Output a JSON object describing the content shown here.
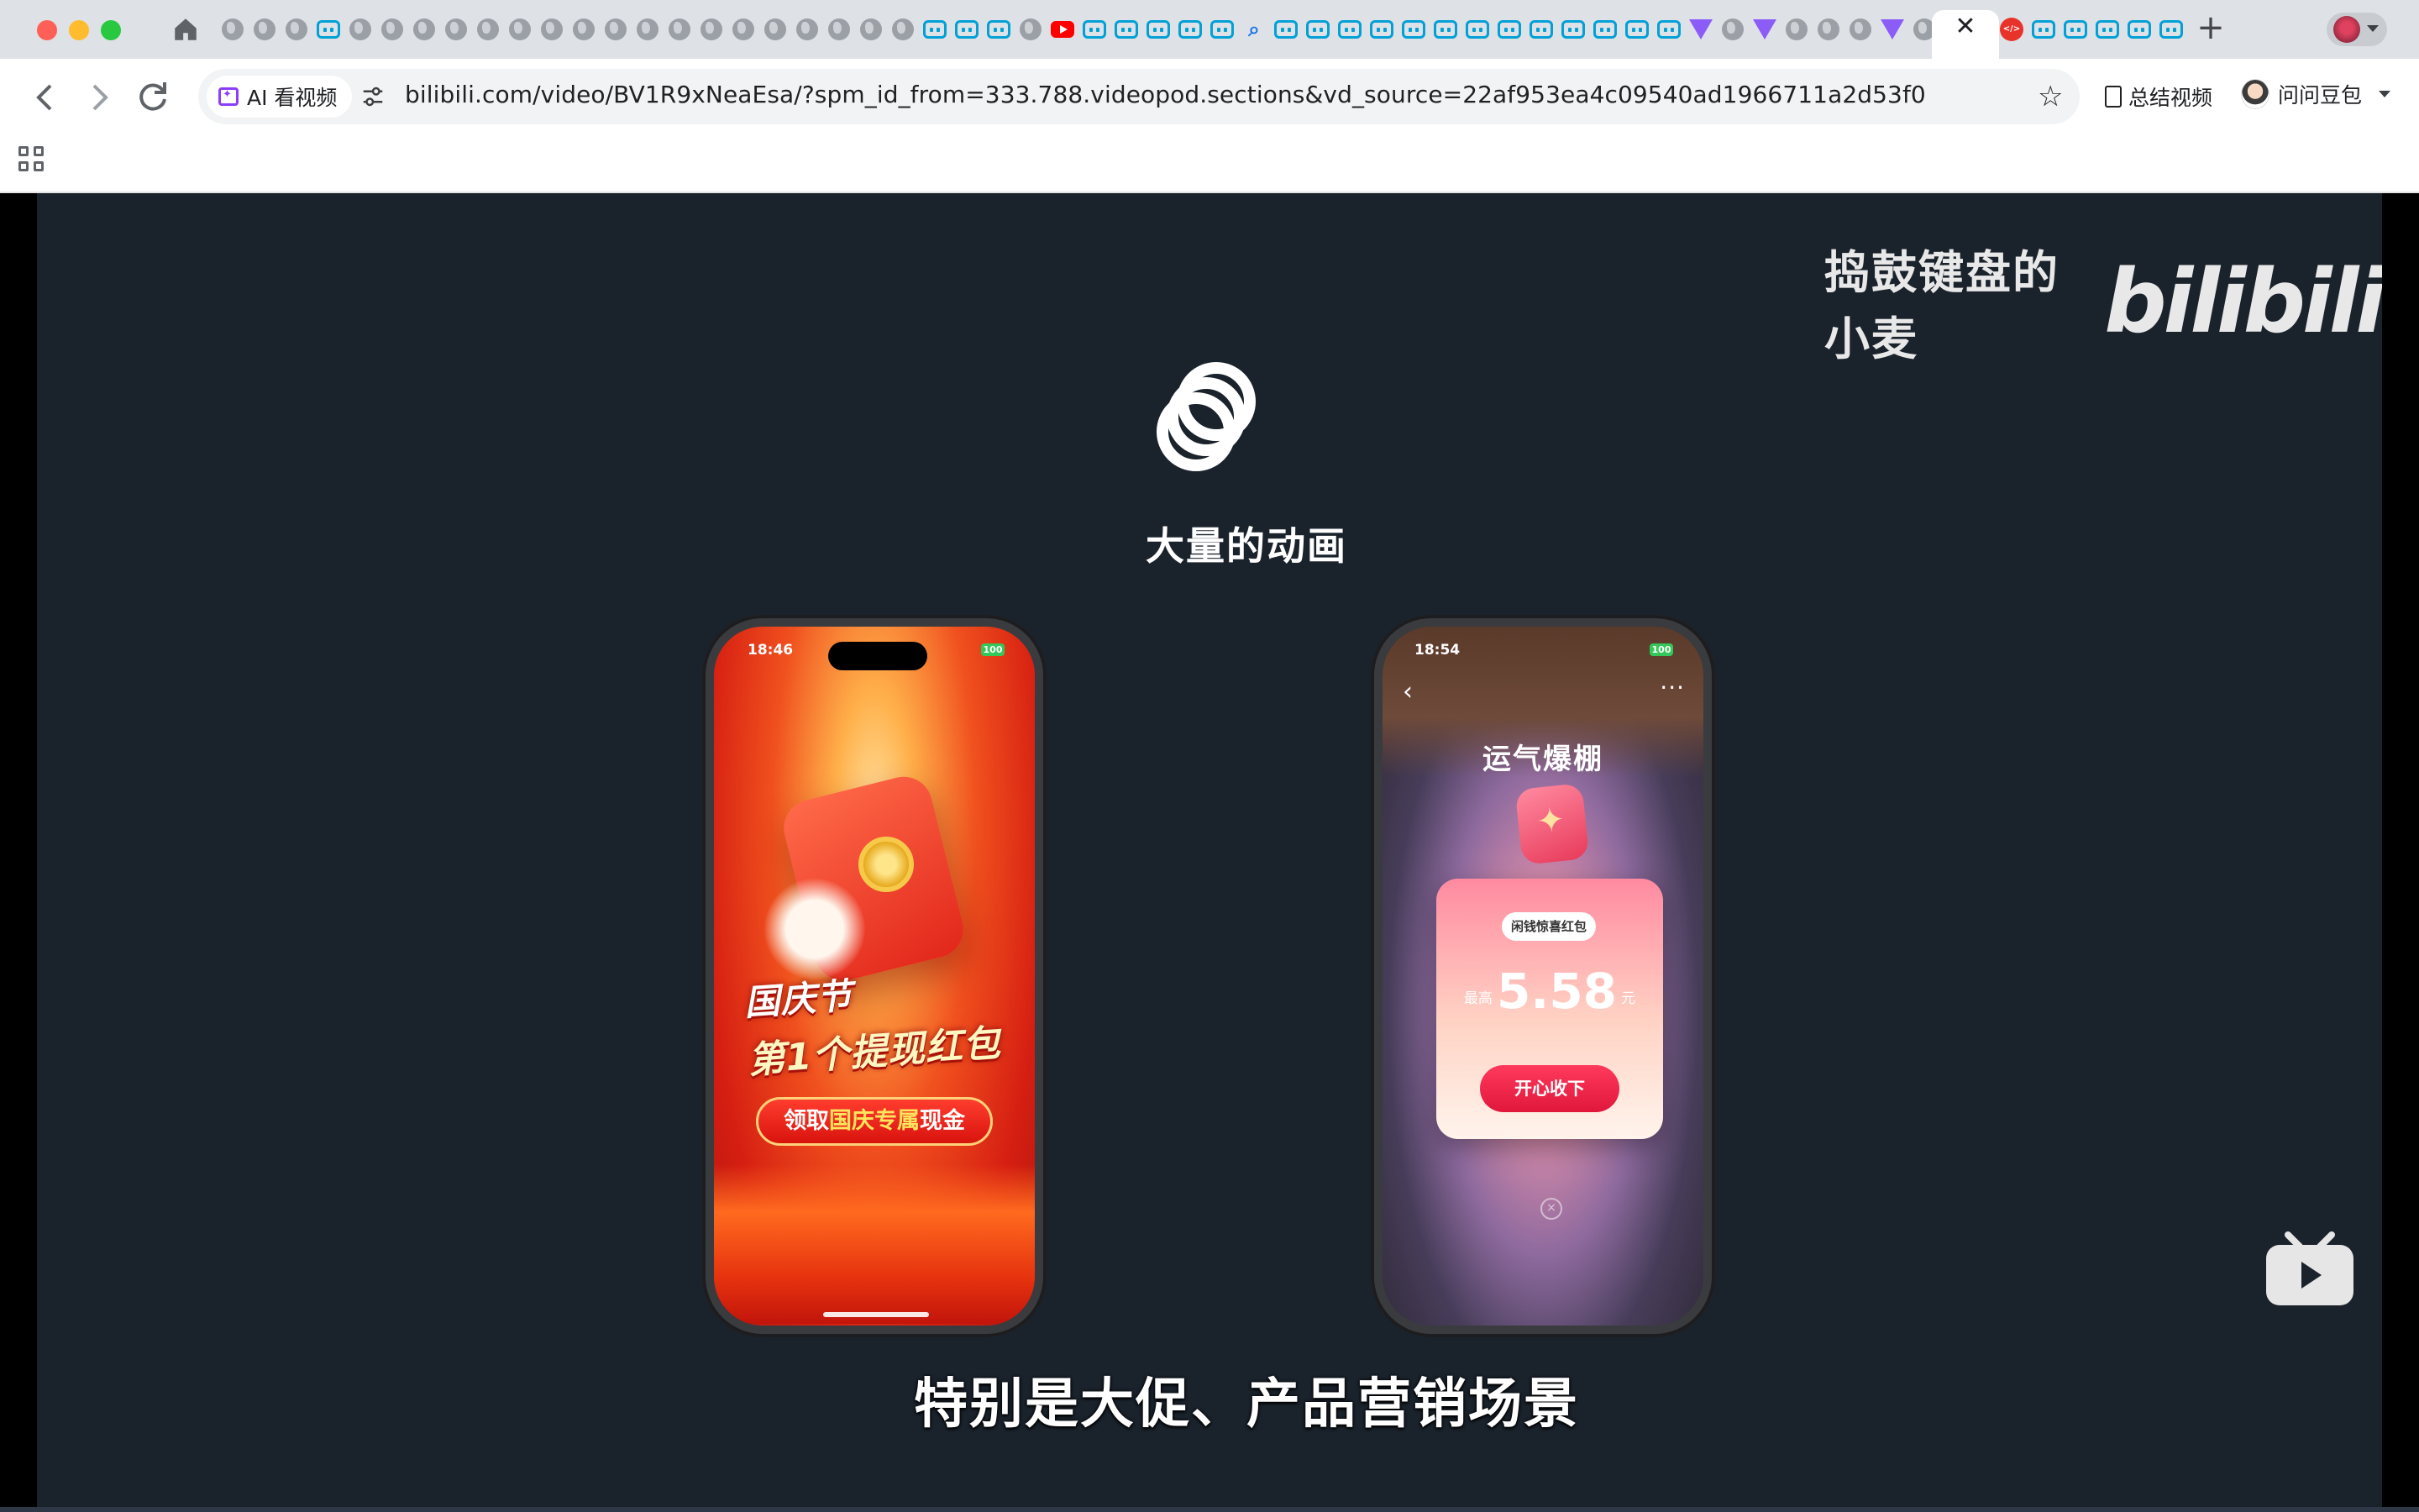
{
  "tabs": {
    "favicons": [
      "globe-icon",
      "globe-icon",
      "globe-icon",
      "bilibili-icon",
      "globe-icon",
      "globe-icon",
      "globe-icon",
      "globe-icon",
      "globe-icon",
      "globe-icon",
      "globe-icon",
      "globe-icon",
      "globe-icon",
      "globe-icon",
      "globe-icon",
      "globe-icon",
      "globe-icon",
      "globe-icon",
      "globe-icon",
      "globe-icon",
      "globe-icon",
      "globe-icon",
      "bilibili-icon",
      "bilibili-icon",
      "bilibili-icon",
      "globe-icon",
      "youtube-icon",
      "bilibili-icon",
      "bilibili-icon",
      "bilibili-icon",
      "bilibili-icon",
      "bilibili-icon",
      "search-icon",
      "bilibili-icon",
      "bilibili-icon",
      "bilibili-icon",
      "bilibili-icon",
      "bilibili-icon",
      "bilibili-icon",
      "bilibili-icon",
      "bilibili-icon",
      "bilibili-icon",
      "bilibili-icon",
      "bilibili-icon",
      "bilibili-icon",
      "bilibili-icon",
      "vite-icon",
      "globe-icon",
      "vite-icon",
      "globe-icon",
      "globe-icon",
      "globe-icon",
      "vite-icon",
      "globe-icon"
    ],
    "after_active": [
      "code-icon",
      "bilibili-icon",
      "bilibili-icon",
      "bilibili-icon",
      "bilibili-icon",
      "bilibili-icon"
    ],
    "close_glyph": "✕",
    "new_tab_glyph": "+"
  },
  "toolbar": {
    "ai_chip_label": "AI 看视频",
    "url_host": "bilibili.com",
    "url_path": "/video/BV1R9xNeaEsa/?spm_id_from=333.788.videopod.sections&vd_source=22af953ea4c09540ad1966711a2d53f0",
    "summary_label": "总结视频",
    "doubao_label": "问问豆包"
  },
  "video": {
    "watermark_author": "捣鼓键盘的小麦",
    "watermark_logo": "bilibili",
    "headline": "大量的动画",
    "subtitle": "特别是大促、产品营销场景",
    "phone_left": {
      "time": "18:46",
      "battery": "100",
      "line1": "国庆节",
      "line2": "第1个提现红包",
      "button_pre": "领取",
      "button_hl": "国庆专属",
      "button_post": "现金"
    },
    "phone_right": {
      "time": "18:54",
      "battery": "100",
      "title": "运气爆棚",
      "card_tag": "闲钱惊喜红包",
      "amount_prefix": "最高",
      "amount": "5.58",
      "amount_unit": "元",
      "button": "开心收下"
    }
  },
  "colors": {
    "accent_blue": "#00a1d6",
    "video_bg": "#1a222c",
    "tabbar_bg": "#dee1e6"
  }
}
